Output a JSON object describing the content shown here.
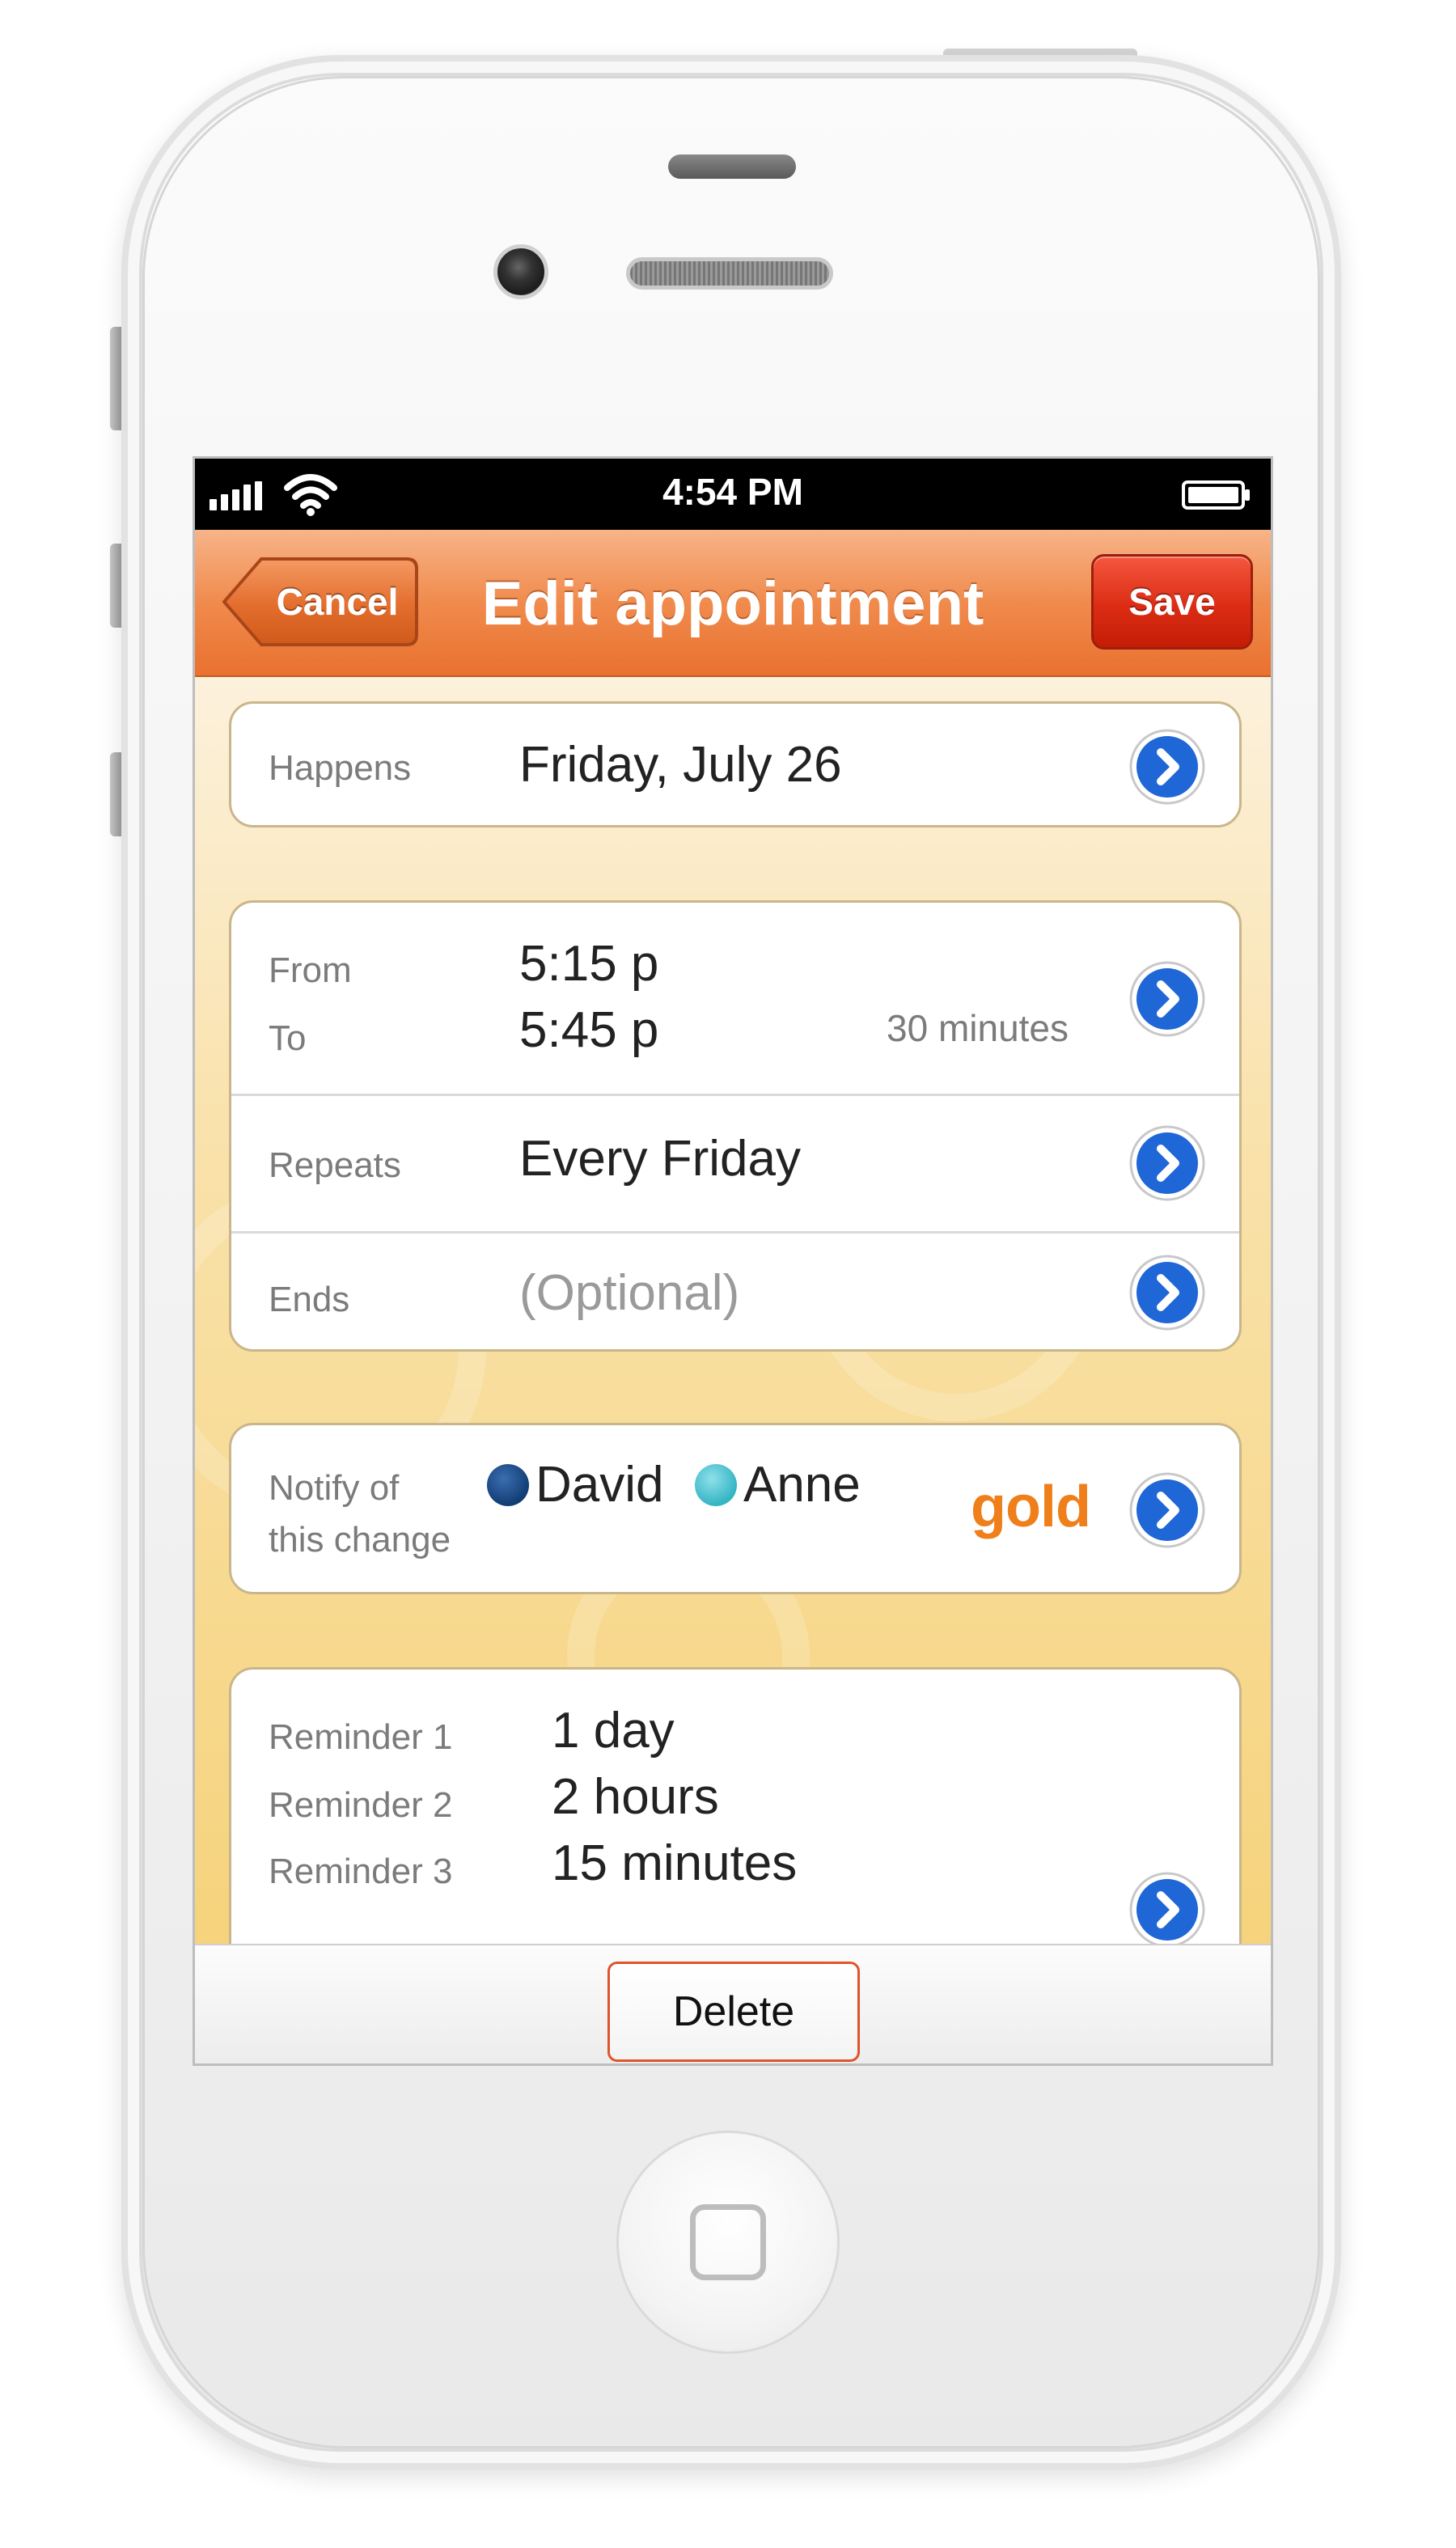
{
  "status_bar": {
    "time": "4:54 PM"
  },
  "nav": {
    "cancel_label": "Cancel",
    "title": "Edit appointment",
    "save_label": "Save"
  },
  "happens": {
    "label": "Happens",
    "value": "Friday, July 26"
  },
  "time_range": {
    "from_label": "From",
    "from_value": "5:15 p",
    "to_label": "To",
    "to_value": "5:45 p",
    "duration": "30 minutes"
  },
  "repeats": {
    "label": "Repeats",
    "value": "Every Friday"
  },
  "ends": {
    "label": "Ends",
    "placeholder": "(Optional)"
  },
  "notify": {
    "label_line1": "Notify of",
    "label_line2": "this change",
    "people": [
      {
        "name": "David",
        "color": "#123d74"
      },
      {
        "name": "Anne",
        "color": "#35b5c4"
      }
    ],
    "badge": "gold"
  },
  "reminders": [
    {
      "label": "Reminder 1",
      "value": "1 day"
    },
    {
      "label": "Reminder 2",
      "value": "2 hours"
    },
    {
      "label": "Reminder 3",
      "value": "15 minutes"
    }
  ],
  "toolbar": {
    "delete_label": "Delete"
  },
  "colors": {
    "nav_orange": "#f08b4d",
    "save_red": "#dc2d14",
    "disclosure_blue": "#1f66d6",
    "gold_badge": "#ef7f1a",
    "delete_border": "#e0542b"
  }
}
